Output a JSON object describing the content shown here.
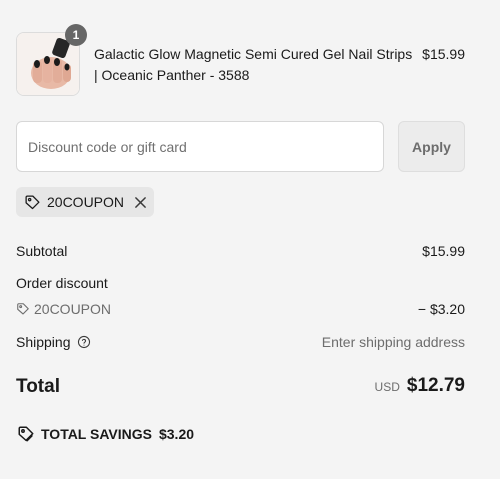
{
  "line_item": {
    "quantity": "1",
    "title": "Galactic Glow Magnetic Semi Cured Gel Nail Strips | Oceanic Panther - 3588",
    "price": "$15.99"
  },
  "discount": {
    "placeholder": "Discount code or gift card",
    "apply_label": "Apply"
  },
  "applied_coupon": {
    "code": "20COUPON"
  },
  "summary": {
    "subtotal_label": "Subtotal",
    "subtotal_value": "$15.99",
    "order_discount_label": "Order discount",
    "discount_code": "20COUPON",
    "discount_value": "− $3.20",
    "shipping_label": "Shipping",
    "shipping_value": "Enter shipping address",
    "total_label": "Total",
    "currency": "USD",
    "total_value": "$12.79",
    "savings_label": "TOTAL SAVINGS",
    "savings_value": "$3.20"
  },
  "icons": {
    "tag": "tag-icon",
    "close": "close-icon",
    "help": "help-circle-icon",
    "savings": "savings-tag-icon"
  },
  "colors": {
    "background": "#f4f4f4",
    "badge": "#666666",
    "chip": "#e6e6e6",
    "muted_text": "#6d6d6d"
  }
}
